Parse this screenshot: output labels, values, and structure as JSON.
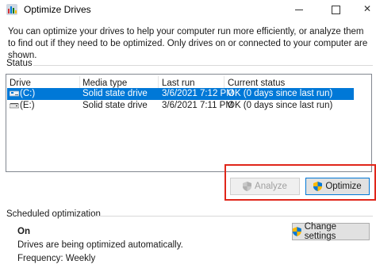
{
  "window": {
    "title": "Optimize Drives",
    "close_glyph": "✕"
  },
  "intro_text": "You can optimize your drives to help your computer run more efficiently, or analyze them to find out if they need to be optimized. Only drives on or connected to your computer are shown.",
  "status": {
    "label": "Status",
    "columns": [
      "Drive",
      "Media type",
      "Last run",
      "Current status"
    ],
    "rows": [
      {
        "drive": "(C:)",
        "media_type": "Solid state drive",
        "last_run": "3/6/2021 7:12 PM",
        "current_status": "OK (0 days since last run)",
        "selected": true
      },
      {
        "drive": "(E:)",
        "media_type": "Solid state drive",
        "last_run": "3/6/2021 7:11 PM",
        "current_status": "OK (0 days since last run)",
        "selected": false
      }
    ]
  },
  "buttons": {
    "analyze": "Analyze",
    "optimize": "Optimize",
    "change_settings": "Change settings"
  },
  "scheduled": {
    "label": "Scheduled optimization",
    "state": "On",
    "description": "Drives are being optimized automatically.",
    "frequency": "Frequency: Weekly"
  },
  "colors": {
    "selection": "#0078d7",
    "highlight": "#e0261a"
  },
  "icons": {
    "app": "optimize-drives-icon",
    "shield": "uac-shield-icon",
    "drive": "drive-icon"
  }
}
